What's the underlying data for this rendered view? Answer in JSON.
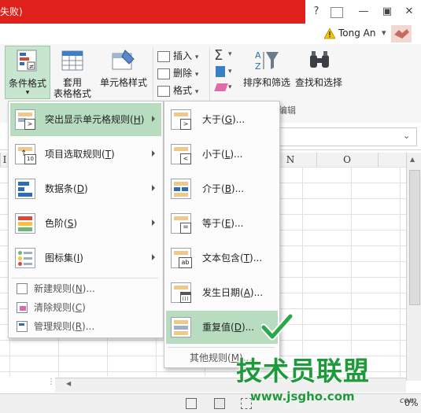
{
  "window": {
    "title_fragment": "失败)",
    "help_label": "?",
    "restore_label": "▣",
    "minimize_label": "—",
    "close_label": "✕",
    "user_name": "Tong An",
    "user_dropdown": "▾"
  },
  "ribbon": {
    "conditional_format": "条件格式",
    "table_format_line1": "套用",
    "table_format_line2": "表格格式",
    "cell_style": "单元格样式",
    "insert": "插入",
    "delete": "删除",
    "format": "格式",
    "sort_filter": "排序和筛选",
    "find_select": "查找和选择",
    "edit_group": "编辑"
  },
  "columns": [
    "I",
    "N",
    "O"
  ],
  "menu": {
    "items": [
      {
        "label": "突出显示单元格规则(",
        "key": "H",
        "tail": ")"
      },
      {
        "label": "项目选取规则(",
        "key": "T",
        "tail": ")"
      },
      {
        "label": "数据条(",
        "key": "D",
        "tail": ")"
      },
      {
        "label": "色阶(",
        "key": "S",
        "tail": ")"
      },
      {
        "label": "图标集(",
        "key": "I",
        "tail": ")"
      }
    ],
    "small_items": [
      {
        "label": "新建规则(",
        "key": "N",
        "tail": ")..."
      },
      {
        "label": "清除规则(",
        "key": "C",
        "tail": ")"
      },
      {
        "label": "管理规则(",
        "key": "R",
        "tail": ")..."
      }
    ]
  },
  "submenu": {
    "items": [
      {
        "label": "大于(",
        "key": "G",
        "tail": ")..."
      },
      {
        "label": "小于(",
        "key": "L",
        "tail": ")..."
      },
      {
        "label": "介于(",
        "key": "B",
        "tail": ")..."
      },
      {
        "label": "等于(",
        "key": "E",
        "tail": ")..."
      },
      {
        "label": "文本包含(",
        "key": "T",
        "tail": ")..."
      },
      {
        "label": "发生日期(",
        "key": "A",
        "tail": ")..."
      },
      {
        "label": "重复值(",
        "key": "D",
        "tail": ")..."
      }
    ],
    "more_rules": "其他规则(",
    "more_key": "M",
    "more_tail": ")...",
    "icon_texts": {
      "gt": ">",
      "lt": "<",
      "ab": "ab",
      "top10": "10"
    }
  },
  "status": {
    "zoom_fragment": "0%"
  },
  "watermark": {
    "brand": "技术员联盟",
    "url": "www.jsgho.com",
    "suffix": "com"
  },
  "colors": {
    "title_red": "#e0201b",
    "highlight": "#b7dcc0",
    "check": "#2aa84a",
    "brand_green": "#1f9a3a"
  }
}
